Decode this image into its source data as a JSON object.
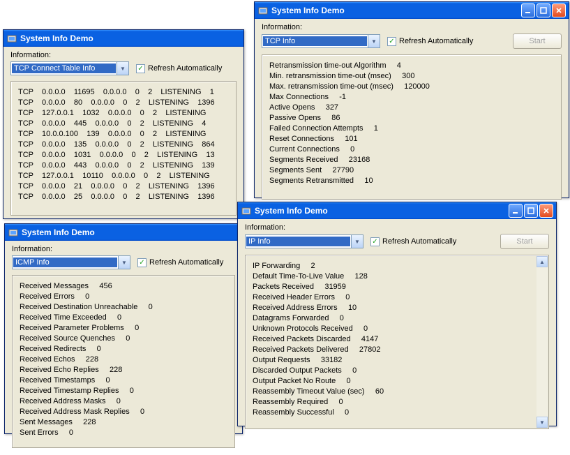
{
  "app_title": "System Info Demo",
  "labels": {
    "information": "Information:",
    "refresh": "Refresh Automatically",
    "start": "Start"
  },
  "win_tcpconn": {
    "dropdown": "TCP Connect Table Info",
    "rows": [
      "TCP    0.0.0.0    11695    0.0.0.0    0    2    LISTENING    1",
      "TCP    0.0.0.0    80    0.0.0.0    0    2    LISTENING    1396",
      "TCP    127.0.0.1    1032    0.0.0.0    0    2    LISTENING",
      "TCP    0.0.0.0    445    0.0.0.0    0    2    LISTENING    4",
      "TCP    10.0.0.100    139    0.0.0.0    0    2    LISTENING",
      "TCP    0.0.0.0    135    0.0.0.0    0    2    LISTENING    864",
      "TCP    0.0.0.0    1031    0.0.0.0    0    2    LISTENING    13",
      "TCP    0.0.0.0    443    0.0.0.0    0    2    LISTENING    139",
      "TCP    127.0.0.1    10110    0.0.0.0    0    2    LISTENING",
      "TCP    0.0.0.0    21    0.0.0.0    0    2    LISTENING    1396",
      "TCP    0.0.0.0    25    0.0.0.0    0    2    LISTENING    1396"
    ]
  },
  "win_tcp": {
    "dropdown": "TCP Info",
    "items": [
      "Retransmission time-out Algorithm     4",
      "Min. retransmission time-out (msec)     300",
      "Max. retransmission time-out (msec)     120000",
      "Max Connections     -1",
      "Active Opens     327",
      "Passive Opens     86",
      "Failed Connection Attempts     1",
      "Reset Connections     101",
      "Current Connections     0",
      "Segments Received     23168",
      "Segments Sent     27790",
      "Segments Retransmitted     10"
    ]
  },
  "win_icmp": {
    "dropdown": "ICMP Info",
    "items": [
      "Received Messages     456",
      "Received Errors     0",
      "Received Destination Unreachable     0",
      "Received Time Exceeded     0",
      "Received Parameter Problems     0",
      "Received Source Quenches     0",
      "Received Redirects     0",
      "Received Echos     228",
      "Received Echo Replies     228",
      "Received Timestamps     0",
      "Received Timestamp Replies     0",
      "Received Address Masks     0",
      "Received Address Mask Replies     0",
      "Sent Messages     228",
      "Sent Errors     0"
    ]
  },
  "win_ip": {
    "dropdown": "IP Info",
    "items": [
      "IP Forwarding     2",
      "Default Time-To-Live Value     128",
      "Packets Received     31959",
      "Received Header Errors     0",
      "Received Address Errors     10",
      "Datagrams Forwarded     0",
      "Unknown Protocols Received     0",
      "Received Packets Discarded     4147",
      "Received Packets Delivered     27802",
      "Output Requests     33182",
      "Discarded Output Packets     0",
      "Output Packet No Route     0",
      "Reassembly Timeout Value (sec)     60",
      "Reassembly Required     0",
      "Reassembly Successful     0"
    ]
  }
}
